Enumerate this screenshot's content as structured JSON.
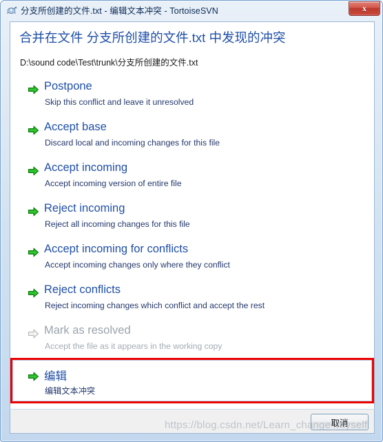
{
  "window": {
    "title": "分支所创建的文件.txt - 编辑文本冲突 - TortoiseSVN",
    "icon": "tortoisesvn-conflict-icon",
    "close_label": "x",
    "ghost_text_1": "​",
    "ghost_text_2": "​"
  },
  "content": {
    "heading": "合并在文件 分支所创建的文件.txt 中发现的冲突",
    "file_path": "D:\\sound code\\Test\\trunk\\分支所创建的文件.txt"
  },
  "options": [
    {
      "title": "Postpone",
      "description": "Skip this conflict and leave it unresolved",
      "icon": "green-arrow-icon",
      "enabled": true
    },
    {
      "title": "Accept base",
      "description": "Discard local and incoming changes for this file",
      "icon": "green-arrow-icon",
      "enabled": true
    },
    {
      "title": "Accept incoming",
      "description": "Accept incoming version of entire file",
      "icon": "green-arrow-icon",
      "enabled": true
    },
    {
      "title": "Reject incoming",
      "description": "Reject all incoming changes for this file",
      "icon": "green-arrow-icon",
      "enabled": true
    },
    {
      "title": "Accept incoming for conflicts",
      "description": "Accept incoming changes only where they conflict",
      "icon": "green-arrow-icon",
      "enabled": true
    },
    {
      "title": "Reject conflicts",
      "description": "Reject incoming changes which conflict and accept the rest",
      "icon": "green-arrow-icon",
      "enabled": true
    },
    {
      "title": "Mark as resolved",
      "description": "Accept the file as it appears in the working copy",
      "icon": "gray-arrow-icon",
      "enabled": false
    },
    {
      "title": "编辑",
      "description": "编辑文本冲突",
      "icon": "green-arrow-icon",
      "enabled": true
    }
  ],
  "annotation": {
    "color": "#ee0000",
    "target": "编辑"
  },
  "footer": {
    "cancel_label": "取消"
  },
  "watermark": {
    "text": "https://blog.csdn.net/Learn_change_myself"
  },
  "colors": {
    "heading": "#1f4fa8",
    "link_title": "#1f4fa8",
    "description": "#22376b",
    "disabled": "#9aa3ad",
    "arrow_green": "#14a314",
    "annotation_red": "#ee0000"
  }
}
